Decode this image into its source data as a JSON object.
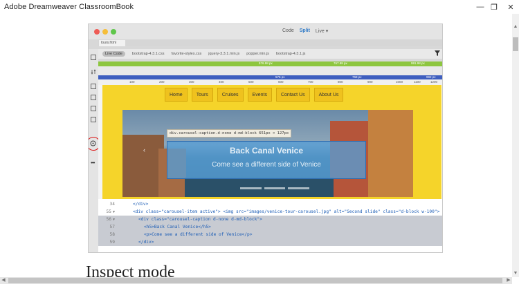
{
  "window": {
    "title": "Adobe Dreamweaver ClassroomBook",
    "min_glyph": "—",
    "max_glyph": "❐",
    "close_glyph": "✕"
  },
  "figure": {
    "view_modes": [
      "Code",
      "Split",
      "Live"
    ],
    "active_mode": "Split",
    "live_dropdown_glyph": "▾",
    "doc_tab": "tours.html",
    "files": [
      "Live Code",
      "bootstrap-4.3.1.css",
      "favorite-styles.css",
      "jquery-3.3.1.min.js",
      "popper.min.js",
      "bootstrap-4.3.1.js"
    ],
    "mq_green_labels": [
      "576.98 px",
      "767.98 px",
      "991.98 px"
    ],
    "mq_blue_labels": [
      "576 px",
      "768 px",
      "992 px"
    ],
    "ruler_ticks": [
      "100",
      "200",
      "300",
      "400",
      "500",
      "600",
      "700",
      "800",
      "900",
      "1000",
      "1100",
      "1200"
    ],
    "nav_items": [
      "Home",
      "Tours",
      "Cruises",
      "Events",
      "Contact Us",
      "About Us"
    ],
    "tooltip": "div.carousel-caption.d-none d-md-block 651px × 127px",
    "caption_title": "Back Canal Venice",
    "caption_text": "Come see a different side of Venice",
    "carousel_prev_glyph": "‹",
    "code_lines": [
      {
        "num": "34",
        "text": "</div>"
      },
      {
        "num": "55",
        "text": "<div class=\"carousel-item active\"> <img src=\"images/venice-tour-carousel.jpg\" alt=\"Second slide\" class=\"d-block w-100\">"
      },
      {
        "num": "56",
        "text": "<div class=\"carousel-caption d-none d-md-block\">"
      },
      {
        "num": "57",
        "text": "<h5>Back Canal Venice</h5>"
      },
      {
        "num": "58",
        "text": "<p>Come see a different side of Venice</p>"
      },
      {
        "num": "59",
        "text": "</div>"
      }
    ]
  },
  "page": {
    "heading": "Inspect mode"
  }
}
